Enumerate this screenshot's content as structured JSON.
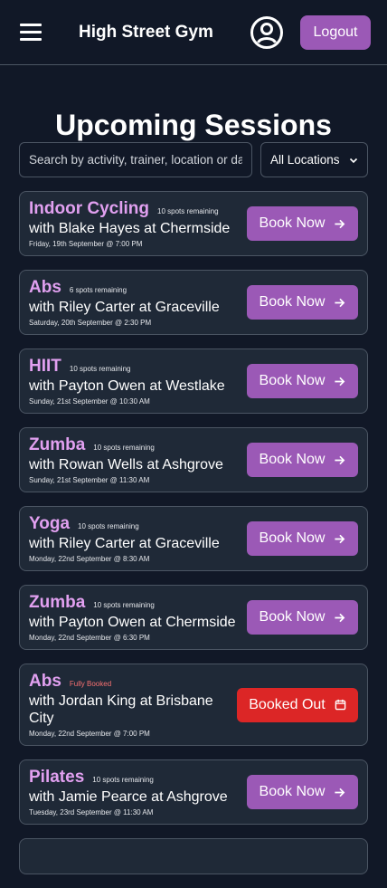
{
  "header": {
    "title": "High Street Gym",
    "logout_label": "Logout"
  },
  "page": {
    "title": "Upcoming Sessions"
  },
  "filters": {
    "search_placeholder": "Search by activity, trainer, location or date",
    "location_selected": "All Locations"
  },
  "icons": {
    "menu": "hamburger-icon",
    "profile": "user-circle-icon",
    "book": "arrow-right-icon",
    "booked_out": "calendar-icon"
  },
  "colors": {
    "background": "#111827",
    "card": "#1f2937",
    "accent": "#9b59b6",
    "activity_text": "#e1a0f0",
    "booked_out": "#dc2626",
    "full_text": "#f87171"
  },
  "sessions": [
    {
      "activity": "Indoor Cycling",
      "spots": "10 spots remaining",
      "with_line": "with Blake Hayes at Chermside",
      "datetime": "Friday, 19th September @ 7:00 PM",
      "button": "Book Now"
    },
    {
      "activity": "Abs",
      "spots": "6 spots remaining",
      "with_line": "with Riley Carter at Graceville",
      "datetime": "Saturday, 20th September @ 2:30 PM",
      "button": "Book Now"
    },
    {
      "activity": "HIIT",
      "spots": "10 spots remaining",
      "with_line": "with Payton Owen at Westlake",
      "datetime": "Sunday, 21st September @ 10:30 AM",
      "button": "Book Now"
    },
    {
      "activity": "Zumba",
      "spots": "10 spots remaining",
      "with_line": "with Rowan Wells at Ashgrove",
      "datetime": "Sunday, 21st September @ 11:30 AM",
      "button": "Book Now"
    },
    {
      "activity": "Yoga",
      "spots": "10 spots remaining",
      "with_line": "with Riley Carter at Graceville",
      "datetime": "Monday, 22nd September @ 8:30 AM",
      "button": "Book Now"
    },
    {
      "activity": "Zumba",
      "spots": "10 spots remaining",
      "with_line": "with Payton Owen at Chermside",
      "datetime": "Monday, 22nd September @ 6:30 PM",
      "button": "Book Now"
    },
    {
      "activity": "Abs",
      "spots": "Fully Booked",
      "with_line": "with Jordan King at Brisbane City",
      "datetime": "Monday, 22nd September @ 7:00 PM",
      "button": "Booked Out"
    },
    {
      "activity": "Pilates",
      "spots": "10 spots remaining",
      "with_line": "with Jamie Pearce at Ashgrove",
      "datetime": "Tuesday, 23rd September @ 11:30 AM",
      "button": "Book Now"
    }
  ]
}
